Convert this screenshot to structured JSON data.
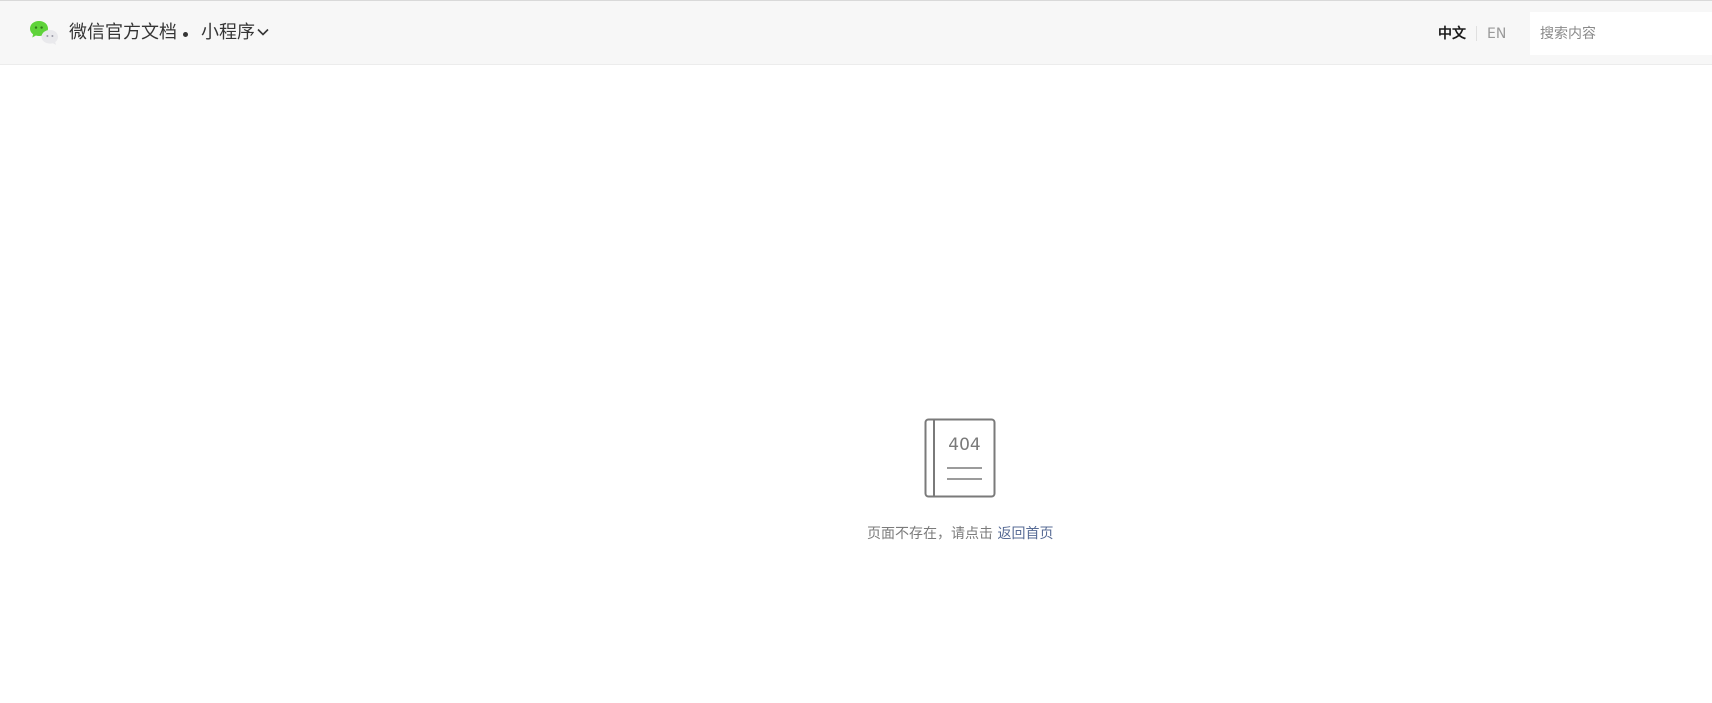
{
  "header": {
    "brand": "微信官方文档",
    "product": "小程序",
    "languages": {
      "zh": "中文",
      "en": "EN",
      "active": "zh"
    },
    "search": {
      "placeholder": "搜索内容",
      "value": ""
    }
  },
  "main": {
    "icon_label": "404",
    "message": "页面不存在，请点击",
    "link_label": "返回首页"
  },
  "colors": {
    "header_bg": "#f7f7f7",
    "link": "#576b95",
    "logo_green": "#5fd33a"
  }
}
